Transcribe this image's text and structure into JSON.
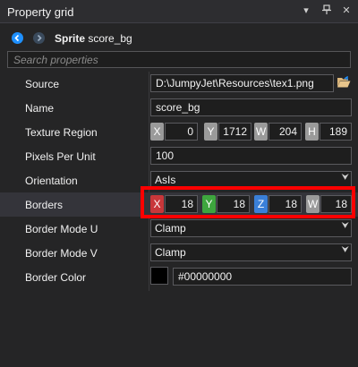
{
  "window": {
    "title": "Property grid",
    "buttons": [
      {
        "name": "dropdown",
        "glyph": "▾"
      },
      {
        "name": "pin",
        "glyph": "📌"
      },
      {
        "name": "close",
        "glyph": "✕"
      }
    ]
  },
  "header": {
    "type": "Sprite",
    "object_name": "score_bg",
    "back_color": "#1e90ff",
    "forward_color": "#3a4a5c"
  },
  "search": {
    "placeholder": "Search properties",
    "value": ""
  },
  "properties": {
    "source": {
      "label": "Source",
      "value": "D:\\JumpyJet\\Resources\\tex1.png"
    },
    "name": {
      "label": "Name",
      "value": "score_bg"
    },
    "texture_region": {
      "label": "Texture Region",
      "fields": [
        {
          "tag": "X",
          "value": "0"
        },
        {
          "tag": "Y",
          "value": "1712"
        },
        {
          "tag": "W",
          "value": "204"
        },
        {
          "tag": "H",
          "value": "189"
        }
      ]
    },
    "pixels_per_unit": {
      "label": "Pixels Per Unit",
      "value": "100"
    },
    "orientation": {
      "label": "Orientation",
      "value": "AsIs"
    },
    "borders": {
      "label": "Borders",
      "fields": [
        {
          "tag": "X",
          "value": "18",
          "color": "#c8373a"
        },
        {
          "tag": "Y",
          "value": "18",
          "color": "#3ea63e"
        },
        {
          "tag": "Z",
          "value": "18",
          "color": "#3a7fd8"
        },
        {
          "tag": "W",
          "value": "18",
          "color": "#9a9a9a"
        }
      ]
    },
    "border_mode_u": {
      "label": "Border Mode U",
      "value": "Clamp"
    },
    "border_mode_v": {
      "label": "Border Mode V",
      "value": "Clamp"
    },
    "border_color": {
      "label": "Border Color",
      "value": "#00000000",
      "swatch": "#000000"
    }
  },
  "highlight_color": "#ff0000"
}
